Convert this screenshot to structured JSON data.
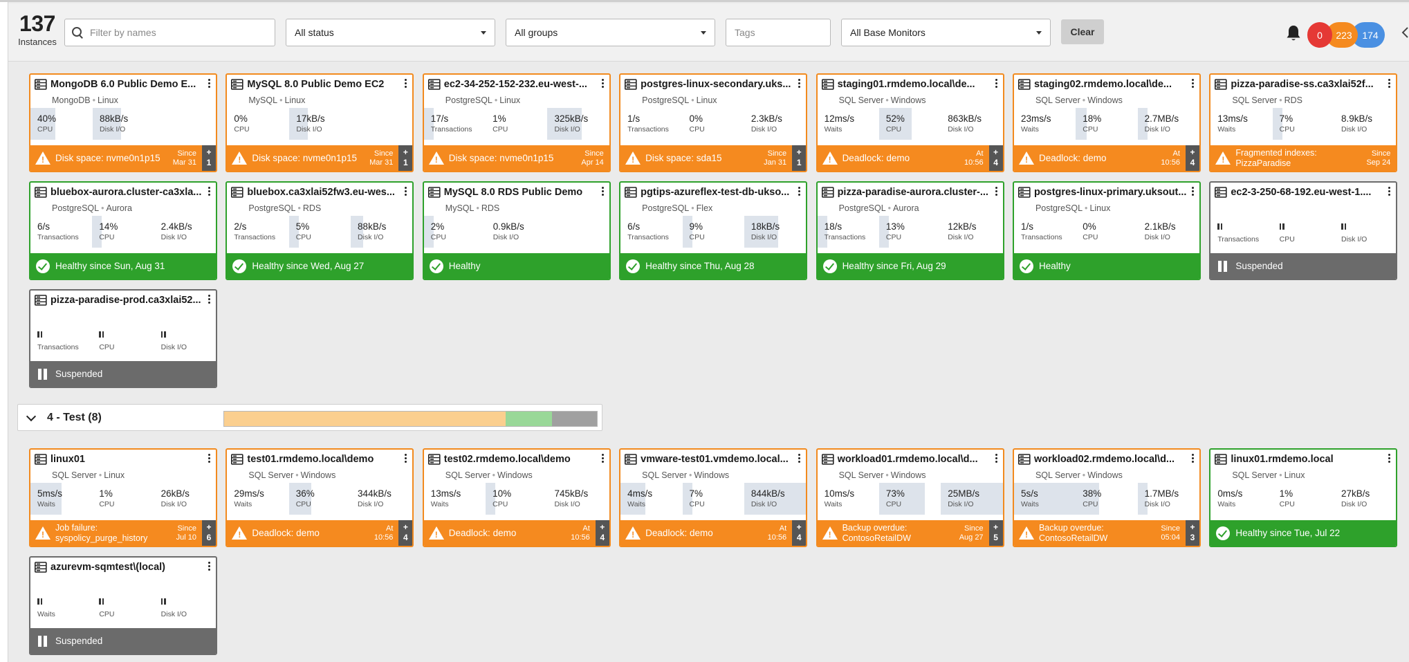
{
  "header": {
    "instance_count": "137",
    "instance_label": "Instances",
    "filter_placeholder": "Filter by names",
    "status_select": "All status",
    "groups_select": "All groups",
    "tags_placeholder": "Tags",
    "base_monitors_select": "All Base Monitors",
    "clear_label": "Clear",
    "badges": [
      {
        "value": "0",
        "color": "#e53935"
      },
      {
        "value": "223",
        "color": "#f58a1f"
      },
      {
        "value": "174",
        "color": "#4a90e2"
      }
    ]
  },
  "group2": {
    "title": "4 - Test (8)",
    "bar": [
      {
        "fraction": 0.755,
        "color": "#fbcf8f"
      },
      {
        "fraction": 0.125,
        "color": "#99d898"
      },
      {
        "fraction": 0.12,
        "color": "#a0a0a0"
      }
    ]
  },
  "cards_group1": [
    {
      "title": "MongoDB 6.0 Public Demo E...",
      "sub1": "MongoDB",
      "sub2": "Linux",
      "border": "orange",
      "metrics": [
        {
          "val": "40%",
          "lbl": "CPU",
          "fill": 0.4
        },
        {
          "val": "88kB/s",
          "lbl": "Disk I/O",
          "fill": 0.45
        }
      ],
      "status": {
        "type": "orange",
        "text": "Disk space: nvme0n1p15",
        "since1": "Since",
        "since2": "Mar 31",
        "plus": "1"
      }
    },
    {
      "title": "MySQL 8.0 Public Demo EC2",
      "sub1": "MySQL",
      "sub2": "Linux",
      "border": "orange",
      "metrics": [
        {
          "val": "0%",
          "lbl": "CPU",
          "fill": 0
        },
        {
          "val": "17kB/s",
          "lbl": "Disk I/O",
          "fill": 0.3
        }
      ],
      "status": {
        "type": "orange",
        "text": "Disk space: nvme0n1p15",
        "since1": "Since",
        "since2": "Mar 31",
        "plus": "1"
      }
    },
    {
      "title": "ec2-34-252-152-232.eu-west-...",
      "sub1": "PostgreSQL",
      "sub2": "Linux",
      "border": "orange",
      "metrics": [
        {
          "val": "17/s",
          "lbl": "Transactions",
          "fill": 0.15
        },
        {
          "val": "1%",
          "lbl": "CPU",
          "fill": 0
        },
        {
          "val": "325kB/s",
          "lbl": "Disk I/O",
          "fill": 0.55
        }
      ],
      "status": {
        "type": "orange",
        "text": "Disk space: nvme0n1p15",
        "since1": "Since",
        "since2": "Apr 14",
        "plus": ""
      }
    },
    {
      "title": "postgres-linux-secondary.uks...",
      "sub1": "PostgreSQL",
      "sub2": "Linux",
      "border": "orange",
      "metrics": [
        {
          "val": "1/s",
          "lbl": "Transactions",
          "fill": 0
        },
        {
          "val": "0%",
          "lbl": "CPU",
          "fill": 0
        },
        {
          "val": "2.3kB/s",
          "lbl": "Disk I/O",
          "fill": 0
        }
      ],
      "status": {
        "type": "orange",
        "text": "Disk space: sda15",
        "since1": "Since",
        "since2": "Jan 31",
        "plus": "1"
      }
    },
    {
      "title": "staging01.rmdemo.local\\de...",
      "sub1": "SQL Server",
      "sub2": "Windows",
      "border": "orange",
      "metrics": [
        {
          "val": "12ms/s",
          "lbl": "Waits",
          "fill": 0
        },
        {
          "val": "52%",
          "lbl": "CPU",
          "fill": 0.52
        },
        {
          "val": "863kB/s",
          "lbl": "Disk I/O",
          "fill": 0
        }
      ],
      "status": {
        "type": "orange",
        "text": "Deadlock: demo",
        "since1": "At",
        "since2": "10:56",
        "plus": "4"
      }
    },
    {
      "title": "staging02.rmdemo.local\\de...",
      "sub1": "SQL Server",
      "sub2": "Windows",
      "border": "orange",
      "metrics": [
        {
          "val": "23ms/s",
          "lbl": "Waits",
          "fill": 0
        },
        {
          "val": "18%",
          "lbl": "CPU",
          "fill": 0.18
        },
        {
          "val": "2.7MB/s",
          "lbl": "Disk I/O",
          "fill": 0.08
        }
      ],
      "status": {
        "type": "orange",
        "text": "Deadlock: demo",
        "since1": "At",
        "since2": "10:56",
        "plus": "4"
      }
    },
    {
      "title": "pizza-paradise-ss.ca3xlai52f...",
      "sub1": "SQL Server",
      "sub2": "RDS",
      "border": "orange",
      "metrics": [
        {
          "val": "13ms/s",
          "lbl": "Waits",
          "fill": 0
        },
        {
          "val": "7%",
          "lbl": "CPU",
          "fill": 0.07
        },
        {
          "val": "8.9kB/s",
          "lbl": "Disk I/O",
          "fill": 0
        }
      ],
      "status": {
        "type": "orange",
        "text": "Fragmented indexes:",
        "text2": "PizzaParadise",
        "since1": "Since",
        "since2": "Sep 24",
        "plus": ""
      }
    },
    {
      "title": "bluebox-aurora.cluster-ca3xla...",
      "sub1": "PostgreSQL",
      "sub2": "Aurora",
      "border": "green",
      "metrics": [
        {
          "val": "6/s",
          "lbl": "Transactions",
          "fill": 0
        },
        {
          "val": "14%",
          "lbl": "CPU",
          "fill": 0.14
        },
        {
          "val": "2.4kB/s",
          "lbl": "Disk I/O",
          "fill": 0
        }
      ],
      "status": {
        "type": "green",
        "text": "Healthy since Sun, Aug 31"
      }
    },
    {
      "title": "bluebox.ca3xlai52fw3.eu-wes...",
      "sub1": "PostgreSQL",
      "sub2": "RDS",
      "border": "green",
      "metrics": [
        {
          "val": "2/s",
          "lbl": "Transactions",
          "fill": 0
        },
        {
          "val": "5%",
          "lbl": "CPU",
          "fill": 0.05
        },
        {
          "val": "88kB/s",
          "lbl": "Disk I/O",
          "fill": 0.2
        }
      ],
      "status": {
        "type": "green",
        "text": "Healthy since Wed, Aug 27"
      }
    },
    {
      "title": "MySQL 8.0 RDS Public Demo",
      "sub1": "MySQL",
      "sub2": "RDS",
      "border": "green",
      "metrics": [
        {
          "val": "2%",
          "lbl": "CPU",
          "fill": 0.02
        },
        {
          "val": "0.9kB/s",
          "lbl": "Disk I/O",
          "fill": 0
        }
      ],
      "status": {
        "type": "green",
        "text": "Healthy"
      }
    },
    {
      "title": "pgtips-azureflex-test-db-ukso...",
      "sub1": "PostgreSQL",
      "sub2": "Flex",
      "border": "green",
      "metrics": [
        {
          "val": "6/s",
          "lbl": "Transactions",
          "fill": 0
        },
        {
          "val": "9%",
          "lbl": "CPU",
          "fill": 0.09
        },
        {
          "val": "18kB/s",
          "lbl": "Disk I/O",
          "fill": 0.55
        }
      ],
      "status": {
        "type": "green",
        "text": "Healthy since Thu, Aug 28"
      }
    },
    {
      "title": "pizza-paradise-aurora.cluster-...",
      "sub1": "PostgreSQL",
      "sub2": "Aurora",
      "border": "green",
      "metrics": [
        {
          "val": "18/s",
          "lbl": "Transactions",
          "fill": 0.1
        },
        {
          "val": "13%",
          "lbl": "CPU",
          "fill": 0.13
        },
        {
          "val": "12kB/s",
          "lbl": "Disk I/O",
          "fill": 0
        }
      ],
      "status": {
        "type": "green",
        "text": "Healthy since Fri, Aug 29"
      }
    },
    {
      "title": "postgres-linux-primary.uksout...",
      "sub1": "PostgreSQL",
      "sub2": "Linux",
      "border": "green",
      "metrics": [
        {
          "val": "1/s",
          "lbl": "Transactions",
          "fill": 0
        },
        {
          "val": "0%",
          "lbl": "CPU",
          "fill": 0
        },
        {
          "val": "2.1kB/s",
          "lbl": "Disk I/O",
          "fill": 0
        }
      ],
      "status": {
        "type": "green",
        "text": "Healthy"
      }
    },
    {
      "title": "ec2-3-250-68-192.eu-west-1....",
      "sub1": "",
      "sub2": "",
      "border": "gray",
      "metrics": [
        {
          "val": "",
          "lbl": "Transactions",
          "fill": 0,
          "paused": true
        },
        {
          "val": "",
          "lbl": "CPU",
          "fill": 0,
          "paused": true
        },
        {
          "val": "",
          "lbl": "Disk I/O",
          "fill": 0,
          "paused": true
        }
      ],
      "status": {
        "type": "gray",
        "text": "Suspended"
      }
    },
    {
      "title": "pizza-paradise-prod.ca3xlai52...",
      "sub1": "",
      "sub2": "",
      "border": "gray",
      "metrics": [
        {
          "val": "",
          "lbl": "Transactions",
          "fill": 0,
          "paused": true
        },
        {
          "val": "",
          "lbl": "CPU",
          "fill": 0,
          "paused": true
        },
        {
          "val": "",
          "lbl": "Disk I/O",
          "fill": 0,
          "paused": true
        }
      ],
      "status": {
        "type": "gray",
        "text": "Suspended"
      }
    }
  ],
  "cards_group2": [
    {
      "title": "linux01",
      "sub1": "SQL Server",
      "sub2": "Linux",
      "border": "orange",
      "metrics": [
        {
          "val": "5ms/s",
          "lbl": "Waits",
          "fill": 0.5
        },
        {
          "val": "1%",
          "lbl": "CPU",
          "fill": 0
        },
        {
          "val": "26kB/s",
          "lbl": "Disk I/O",
          "fill": 0
        }
      ],
      "status": {
        "type": "orange",
        "text": "Job failure:",
        "text2": "syspolicy_purge_history",
        "since1": "Since",
        "since2": "Jul 10",
        "plus": "6"
      }
    },
    {
      "title": "test01.rmdemo.local\\demo",
      "sub1": "SQL Server",
      "sub2": "Windows",
      "border": "orange",
      "metrics": [
        {
          "val": "29ms/s",
          "lbl": "Waits",
          "fill": 0
        },
        {
          "val": "36%",
          "lbl": "CPU",
          "fill": 0.36
        },
        {
          "val": "344kB/s",
          "lbl": "Disk I/O",
          "fill": 0
        }
      ],
      "status": {
        "type": "orange",
        "text": "Deadlock: demo",
        "since1": "At",
        "since2": "10:56",
        "plus": "4"
      }
    },
    {
      "title": "test02.rmdemo.local\\demo",
      "sub1": "SQL Server",
      "sub2": "Windows",
      "border": "orange",
      "metrics": [
        {
          "val": "13ms/s",
          "lbl": "Waits",
          "fill": 0
        },
        {
          "val": "10%",
          "lbl": "CPU",
          "fill": 0.1
        },
        {
          "val": "745kB/s",
          "lbl": "Disk I/O",
          "fill": 0
        }
      ],
      "status": {
        "type": "orange",
        "text": "Deadlock: demo",
        "since1": "At",
        "since2": "10:56",
        "plus": "4"
      }
    },
    {
      "title": "vmware-test01.vmdemo.local...",
      "sub1": "SQL Server",
      "sub2": "Windows",
      "border": "orange",
      "metrics": [
        {
          "val": "4ms/s",
          "lbl": "Waits",
          "fill": 0.4
        },
        {
          "val": "7%",
          "lbl": "CPU",
          "fill": 0.07
        },
        {
          "val": "844kB/s",
          "lbl": "Disk I/O",
          "fill": 1.0
        }
      ],
      "status": {
        "type": "orange",
        "text": "Deadlock: demo",
        "since1": "At",
        "since2": "10:56",
        "plus": "4"
      }
    },
    {
      "title": "workload01.rmdemo.local\\d...",
      "sub1": "SQL Server",
      "sub2": "Windows",
      "border": "orange",
      "metrics": [
        {
          "val": "10ms/s",
          "lbl": "Waits",
          "fill": 0
        },
        {
          "val": "73%",
          "lbl": "CPU",
          "fill": 0.73
        },
        {
          "val": "25MB/s",
          "lbl": "Disk I/O",
          "fill": 1.0
        }
      ],
      "status": {
        "type": "orange",
        "text": "Backup overdue:",
        "text2": "ContosoRetailDW",
        "since1": "Since",
        "since2": "Aug 27",
        "plus": "5"
      }
    },
    {
      "title": "workload02.rmdemo.local\\d...",
      "sub1": "SQL Server",
      "sub2": "Windows",
      "border": "orange",
      "metrics": [
        {
          "val": "5s/s",
          "lbl": "Waits",
          "fill": 1.0
        },
        {
          "val": "38%",
          "lbl": "CPU",
          "fill": 0.38
        },
        {
          "val": "1.7MB/s",
          "lbl": "Disk I/O",
          "fill": 0.08
        }
      ],
      "status": {
        "type": "orange",
        "text": "Backup overdue:",
        "text2": "ContosoRetailDW",
        "since1": "Since",
        "since2": "05:04",
        "plus": "3"
      }
    },
    {
      "title": "linux01.rmdemo.local",
      "sub1": "SQL Server",
      "sub2": "Linux",
      "border": "green",
      "metrics": [
        {
          "val": "0ms/s",
          "lbl": "Waits",
          "fill": 0
        },
        {
          "val": "1%",
          "lbl": "CPU",
          "fill": 0
        },
        {
          "val": "27kB/s",
          "lbl": "Disk I/O",
          "fill": 0
        }
      ],
      "status": {
        "type": "green",
        "text": "Healthy since Tue, Jul 22"
      }
    },
    {
      "title": "azurevm-sqmtest\\(local)",
      "sub1": "",
      "sub2": "",
      "border": "gray",
      "metrics": [
        {
          "val": "",
          "lbl": "Waits",
          "fill": 0,
          "paused": true
        },
        {
          "val": "",
          "lbl": "CPU",
          "fill": 0,
          "paused": true
        },
        {
          "val": "",
          "lbl": "Disk I/O",
          "fill": 0,
          "paused": true
        }
      ],
      "status": {
        "type": "gray",
        "text": "Suspended"
      }
    }
  ]
}
